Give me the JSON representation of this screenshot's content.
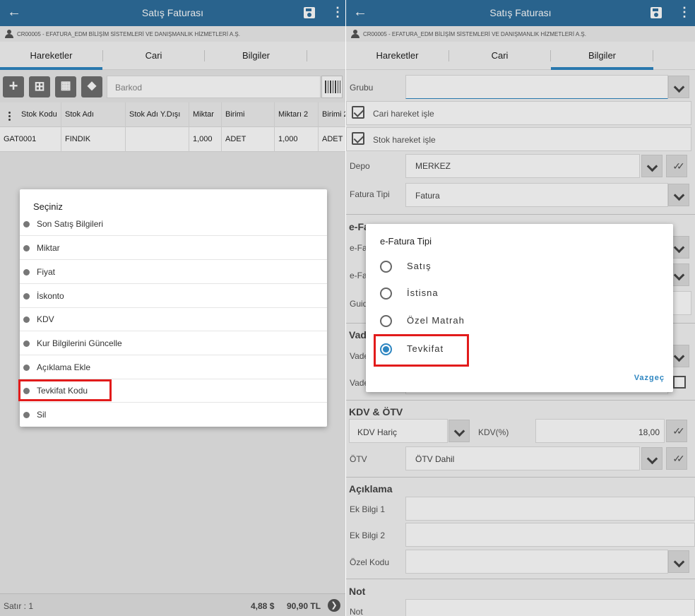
{
  "left": {
    "appbar": {
      "title": "Satış Faturası"
    },
    "company": "CR00005 - EFATURA_EDM BİLİŞİM SİSTEMLERİ VE DANIŞMANLIK HİZMETLERİ A.Ş.",
    "tabs": [
      {
        "label": "Hareketler"
      },
      {
        "label": "Cari"
      },
      {
        "label": "Bilgiler"
      }
    ],
    "active_tab": "Hareketler",
    "barcode_placeholder": "Barkod",
    "grid": {
      "columns": [
        "Stok Kodu",
        "Stok Adı",
        "Stok Adı Y.Dışı",
        "Miktar",
        "Birimi",
        "Miktarı 2",
        "Birimi 2"
      ],
      "rows": [
        [
          "GAT0001",
          "FINDIK",
          "",
          "1,000",
          "ADET",
          "1,000",
          "ADET"
        ]
      ]
    },
    "dialog": {
      "title": "Seçiniz",
      "options": [
        "Son Satış Bilgileri",
        "Miktar",
        "Fiyat",
        "İskonto",
        "KDV",
        "Kur Bilgilerini Güncelle",
        "Açıklama Ekle",
        "Tevkifat Kodu",
        "Sil"
      ],
      "highlighted": "Tevkifat Kodu"
    },
    "footer": {
      "rows": "Satır : 1",
      "usd": "4,88 $",
      "tl": "90,90 TL"
    }
  },
  "right": {
    "appbar": {
      "title": "Satış Faturası"
    },
    "company": "CR00005 - EFATURA_EDM BİLİŞİM SİSTEMLERİ VE DANIŞMANLIK HİZMETLERİ A.Ş.",
    "tabs": [
      {
        "label": "Hareketler"
      },
      {
        "label": "Cari"
      },
      {
        "label": "Bilgiler"
      }
    ],
    "active_tab": "Bilgiler",
    "form": {
      "grubu_label": "Grubu",
      "cari_hareket": "Cari hareket işle",
      "stok_hareket": "Stok hareket işle",
      "depo_label": "Depo",
      "depo_value": "MERKEZ",
      "fatura_tipi_label": "Fatura Tipi",
      "fatura_tipi_value": "Fatura",
      "efatura_section": "e-Fa",
      "efatura_label_1": "e-Fa",
      "efatura_label_2": "e-Fa",
      "guid_label": "Guid",
      "vade_section": "Vad",
      "vade_label_1": "Vade",
      "vade_label_2": "Vade",
      "kdv_section": "KDV & ÖTV",
      "kdv_value": "KDV Hariç",
      "kdv_pct_label": "KDV(%)",
      "kdv_pct_value": "18,00",
      "otv_label": "ÖTV",
      "otv_value": "ÖTV Dahil",
      "aciklama_section": "Açıklama",
      "ek_bilgi_1": "Ek Bilgi 1",
      "ek_bilgi_2": "Ek Bilgi 2",
      "ozel_kodu": "Özel Kodu",
      "not_section": "Not",
      "not_label": "Not"
    },
    "dialog": {
      "title": "e-Fatura Tipi",
      "options": [
        {
          "label": "Satış",
          "selected": false
        },
        {
          "label": "İstisna",
          "selected": false
        },
        {
          "label": "Özel Matrah",
          "selected": false
        },
        {
          "label": "Tevkifat",
          "selected": true
        }
      ],
      "cancel": "Vazgeç"
    }
  },
  "colors": {
    "appbar": "#2e6f9e",
    "accent": "#2e86c1",
    "highlight": "#e21b1b"
  },
  "icons": [
    "back-arrow-icon",
    "save-icon",
    "more-vert-icon",
    "person-icon",
    "plus-icon",
    "add-box-icon",
    "boxes-icon",
    "tag-icon",
    "barcode-icon",
    "chevron-down-icon",
    "double-check-icon",
    "checkbox-checked-icon",
    "calendar-icon",
    "chevron-right-circle-icon"
  ]
}
